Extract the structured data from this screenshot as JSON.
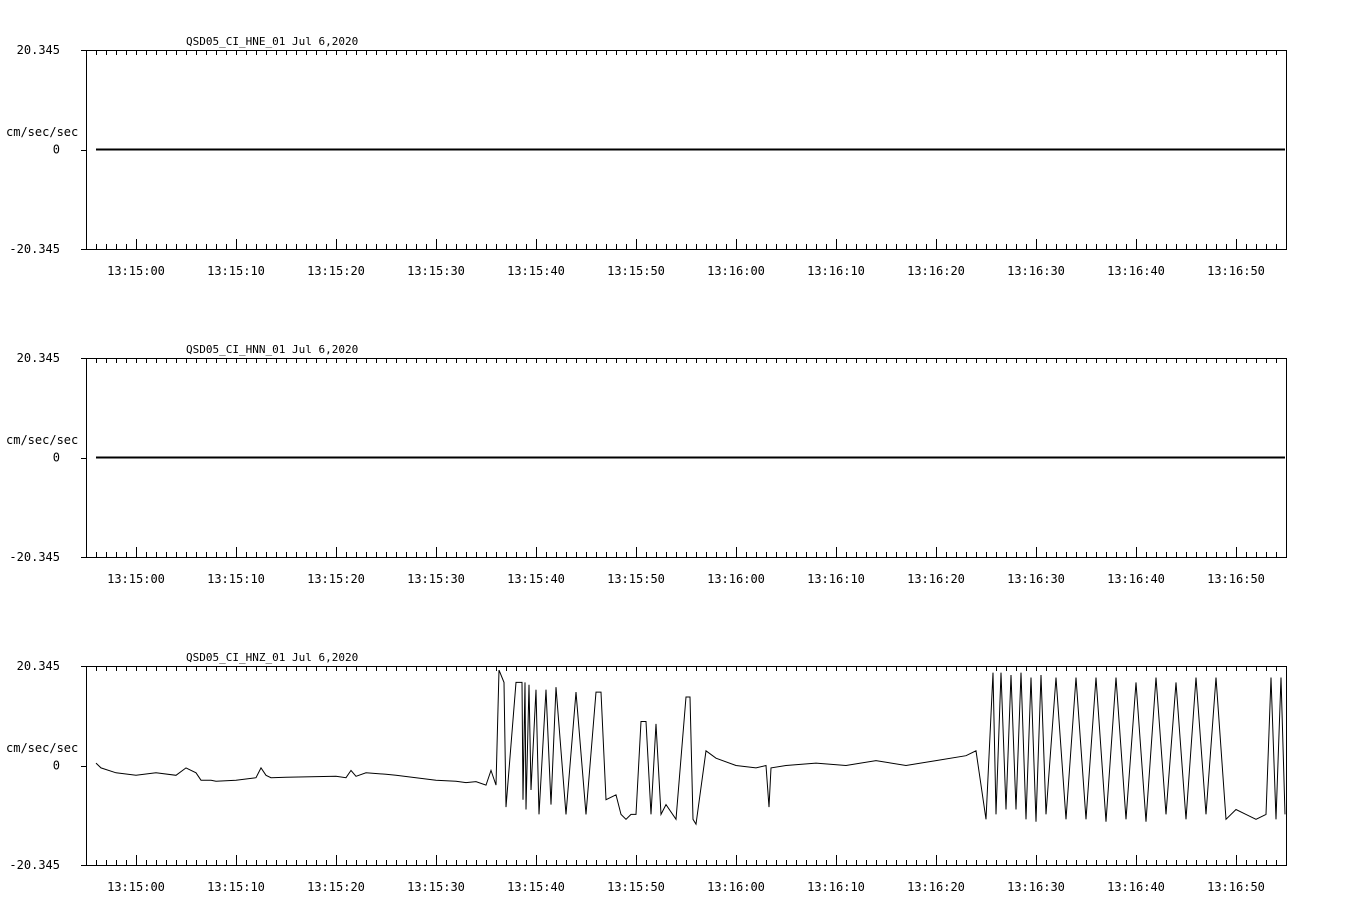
{
  "chart_data": [
    {
      "type": "line",
      "title": "QSD05_CI_HNE_01  Jul 6,2020",
      "ylabel": "cm/sec/sec",
      "ylim": [
        -20.345,
        20.345
      ],
      "y_tick_labels": [
        "20.345",
        "0",
        "-20.345"
      ],
      "xlim_seconds": [
        -5,
        115
      ],
      "x_tick_labels": [
        "13:15:00",
        "13:15:10",
        "13:15:20",
        "13:15:30",
        "13:15:40",
        "13:15:50",
        "13:16:00",
        "13:16:10",
        "13:16:20",
        "13:16:30",
        "13:16:40",
        "13:16:50"
      ],
      "x_tick_seconds": [
        0,
        10,
        20,
        30,
        40,
        50,
        60,
        70,
        80,
        90,
        100,
        110
      ],
      "series": [
        {
          "x": [
            -4,
            114.9
          ],
          "y": [
            0,
            0
          ]
        }
      ]
    },
    {
      "type": "line",
      "title": "QSD05_CI_HNN_01  Jul 6,2020",
      "ylabel": "cm/sec/sec",
      "ylim": [
        -20.345,
        20.345
      ],
      "y_tick_labels": [
        "20.345",
        "0",
        "-20.345"
      ],
      "xlim_seconds": [
        -5,
        115
      ],
      "x_tick_labels": [
        "13:15:00",
        "13:15:10",
        "13:15:20",
        "13:15:30",
        "13:15:40",
        "13:15:50",
        "13:16:00",
        "13:16:10",
        "13:16:20",
        "13:16:30",
        "13:16:40",
        "13:16:50"
      ],
      "x_tick_seconds": [
        0,
        10,
        20,
        30,
        40,
        50,
        60,
        70,
        80,
        90,
        100,
        110
      ],
      "series": [
        {
          "x": [
            -4,
            114.9
          ],
          "y": [
            0,
            0
          ]
        }
      ]
    },
    {
      "type": "line",
      "title": "QSD05_CI_HNZ_01  Jul 6,2020",
      "ylabel": "cm/sec/sec",
      "ylim": [
        -20.345,
        20.345
      ],
      "y_tick_labels": [
        "20.345",
        "0",
        "-20.345"
      ],
      "xlim_seconds": [
        -5,
        115
      ],
      "x_tick_labels": [
        "13:15:00",
        "13:15:10",
        "13:15:20",
        "13:15:30",
        "13:15:40",
        "13:15:50",
        "13:16:00",
        "13:16:10",
        "13:16:20",
        "13:16:30",
        "13:16:40",
        "13:16:50"
      ],
      "x_tick_seconds": [
        0,
        10,
        20,
        30,
        40,
        50,
        60,
        70,
        80,
        90,
        100,
        110
      ],
      "series": [
        {
          "x": [
            -4,
            -3.5,
            -2,
            0,
            2,
            4,
            5,
            6,
            6.5,
            7,
            7.5,
            8,
            10,
            12,
            12.5,
            13,
            13.5,
            15,
            20,
            21,
            21.5,
            22,
            23,
            25,
            26,
            28,
            30,
            32,
            33,
            34,
            35,
            35.5,
            36,
            36.3,
            36.8,
            37,
            38,
            38.6,
            38.7,
            38.9,
            39,
            39.3,
            39.5,
            40,
            40.3,
            41,
            41.5,
            42,
            43,
            44,
            45,
            46,
            46.5,
            47,
            48,
            48.5,
            49,
            49.5,
            50,
            50.5,
            51,
            51.5,
            52,
            52.5,
            53,
            54,
            55,
            55.4,
            55.7,
            56,
            57,
            58,
            60,
            62,
            63,
            63.3,
            63.5,
            65,
            68,
            71,
            74,
            77,
            80,
            83,
            84,
            85,
            85.7,
            86,
            86.5,
            87,
            87.5,
            88,
            88.5,
            89,
            89.5,
            90,
            90.5,
            91,
            92,
            93,
            94,
            95,
            96,
            97,
            98,
            99,
            100,
            101,
            102,
            103,
            104,
            105,
            106,
            107,
            108,
            109,
            110,
            111,
            112,
            113,
            113.5,
            114,
            114.5,
            114.9
          ],
          "y": [
            0.5,
            -0.5,
            -1.5,
            -2,
            -1.5,
            -2,
            -0.5,
            -1.5,
            -3,
            -3,
            -3,
            -3.2,
            -3,
            -2.5,
            -0.5,
            -2,
            -2.5,
            -2.4,
            -2.2,
            -2.5,
            -1,
            -2.2,
            -1.5,
            -1.8,
            -2,
            -2.5,
            -3,
            -3.2,
            -3.5,
            -3.3,
            -4,
            -1,
            -4,
            19.5,
            17,
            -8.5,
            17,
            17,
            -7,
            17,
            -9,
            16.5,
            -5,
            15.5,
            -10,
            15.5,
            -8,
            16,
            -10,
            15,
            -10,
            15,
            15,
            -7,
            -6,
            -10,
            -11,
            -10,
            -10,
            9,
            9,
            -10,
            8.5,
            -10,
            -8,
            -11,
            14,
            14,
            -11,
            -12,
            3,
            1.5,
            0,
            -0.5,
            0,
            -8.5,
            -0.5,
            0,
            0.5,
            0,
            1,
            0,
            1,
            2,
            3,
            -11,
            19,
            -10,
            19,
            -9,
            18.5,
            -9,
            19,
            -11,
            18,
            -11.5,
            18.5,
            -10,
            18,
            -11,
            18,
            -11,
            18,
            -11.5,
            18,
            -11,
            17,
            -11.5,
            18,
            -10,
            17,
            -11,
            18,
            -10,
            18,
            -11,
            -9,
            -10,
            -11,
            -10,
            18,
            -11,
            18,
            -10
          ]
        }
      ]
    }
  ]
}
